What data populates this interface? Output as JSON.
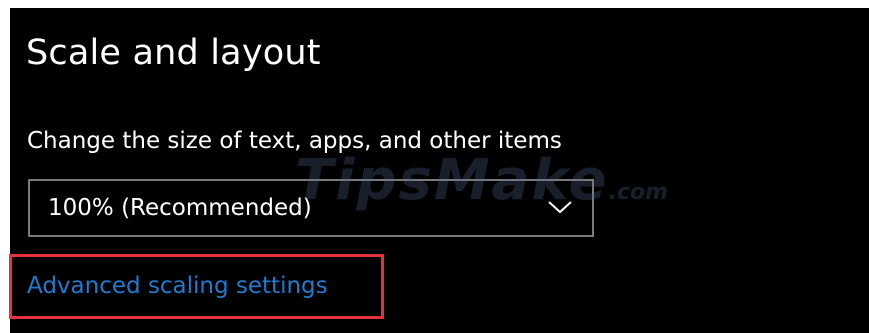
{
  "section": {
    "title": "Scale and layout"
  },
  "scale_setting": {
    "label": "Change the size of text, apps, and other items",
    "selected_value": "100% (Recommended)"
  },
  "advanced_link": {
    "label": "Advanced scaling settings"
  },
  "watermark": {
    "text": "TipsMake",
    "suffix": ".com"
  },
  "colors": {
    "background": "#000000",
    "text": "#ffffff",
    "link": "#1e7bd0",
    "highlight": "#e5323b",
    "dropdown_border": "#7a7a7a"
  },
  "icons": {
    "dropdown": "chevron-down-icon"
  }
}
